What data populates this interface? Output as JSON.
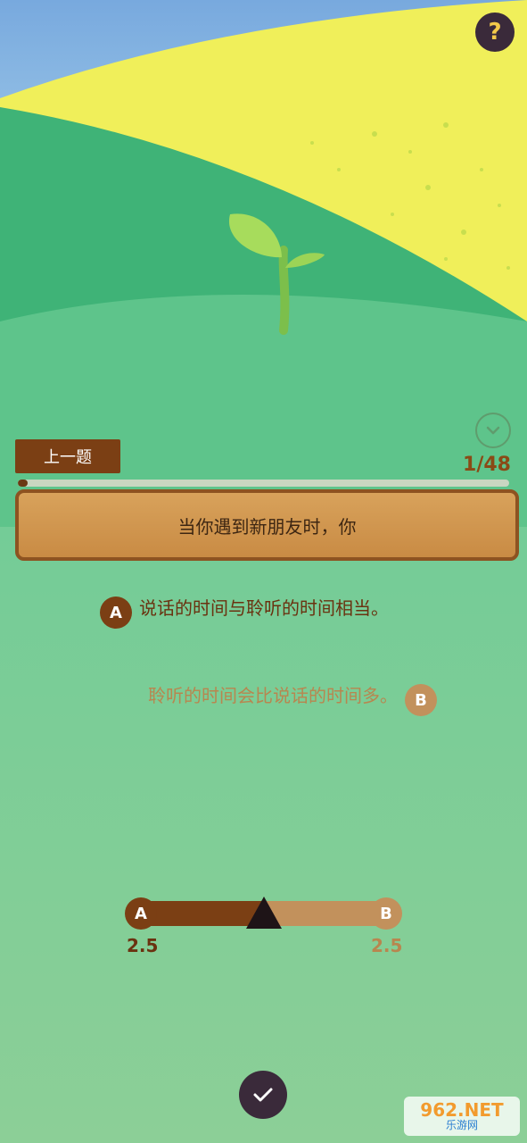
{
  "header": {
    "help_label": "?"
  },
  "question": {
    "prev_label": "上一题",
    "current": 1,
    "total": 48,
    "progress_text": "1/48",
    "text": "当你遇到新朋友时，你"
  },
  "options": [
    {
      "badge": "A",
      "text": "说话的时间与聆听的时间相当。"
    },
    {
      "badge": "B",
      "text": "聆听的时间会比说话的时间多。"
    }
  ],
  "slider": {
    "a_label": "A",
    "b_label": "B",
    "a_score": "2.5",
    "b_score": "2.5",
    "position_fraction": 0.5
  },
  "watermark": {
    "main": "962.NET",
    "sub": "乐游网"
  },
  "colors": {
    "brown": "#7b3f14",
    "tan": "#c2915c",
    "dark": "#3a2a3a",
    "gold": "#f3c94a"
  },
  "icons": {
    "help": "question-icon",
    "collapse": "chevron-down-icon",
    "thumb": "triangle-icon",
    "confirm": "check-icon",
    "sprout": "sprout-icon"
  }
}
